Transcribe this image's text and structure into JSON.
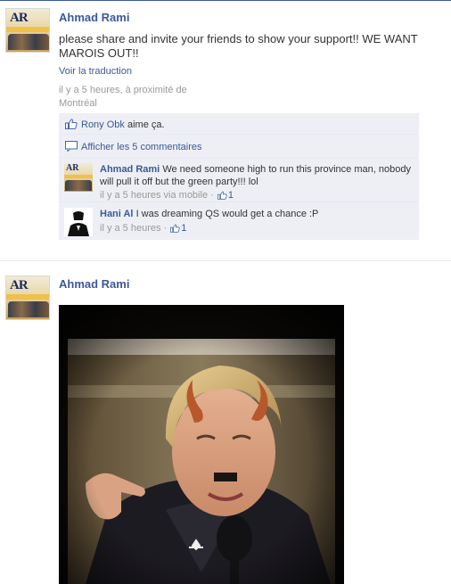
{
  "post1": {
    "author": "Ahmad Rami",
    "message": "please share and invite your friends to show your support!! WE WANT MAROIS OUT!!",
    "see_translation": "Voir la traduction",
    "time_location": "il y a 5 heures, à proximité de Montréal",
    "like_line": {
      "name": "Rony Obk",
      "text": "aime ça."
    },
    "show_comments": "Afficher les 5 commentaires",
    "comments": [
      {
        "name": "Ahmad Rami",
        "text": "We need someone high to run this province man, nobody will pull it off but the green party!!! lol",
        "time": "il y a 5 heures via mobile",
        "likes": "1"
      },
      {
        "name": "Hani Al",
        "text": "I was dreaming QS would get a chance :P",
        "time": "il y a 5 heures",
        "likes": "1"
      }
    ]
  },
  "post2": {
    "author": "Ahmad Rami",
    "avatar_text": "AR"
  },
  "colors": {
    "link": "#3b5998",
    "ufi_bg": "#edeff4",
    "meta": "#999999"
  },
  "icons": [
    "thumbs-up-icon",
    "comment-icon",
    "like-icon"
  ]
}
